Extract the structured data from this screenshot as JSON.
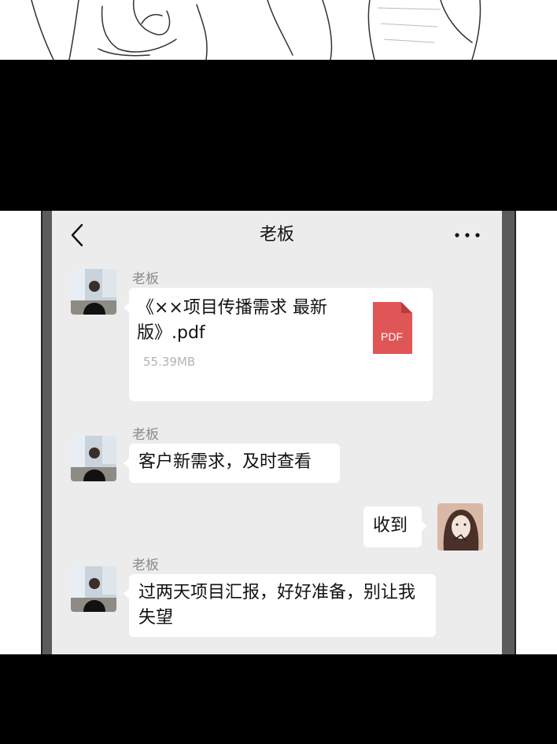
{
  "chat": {
    "title": "老板"
  },
  "messages": [
    {
      "sender": "老板",
      "type": "file",
      "file_name": "《××项目传播需求 最新版》.pdf",
      "file_size": "55.39MB",
      "file_icon_label": "PDF"
    },
    {
      "sender": "老板",
      "type": "text",
      "text": "客户新需求，及时查看"
    },
    {
      "sender": "",
      "type": "text",
      "text": "收到"
    },
    {
      "sender": "老板",
      "type": "text",
      "text": "过两天项目汇报，好好准备，别让我失望"
    }
  ],
  "colors": {
    "chat_background": "#ececec",
    "bubble": "#ffffff",
    "pdf_icon": "#e05555",
    "name_text": "#8a8a8a"
  },
  "icons": {
    "back": "chevron-left-icon",
    "more": "more-dots-icon",
    "file": "pdf-file-icon"
  }
}
